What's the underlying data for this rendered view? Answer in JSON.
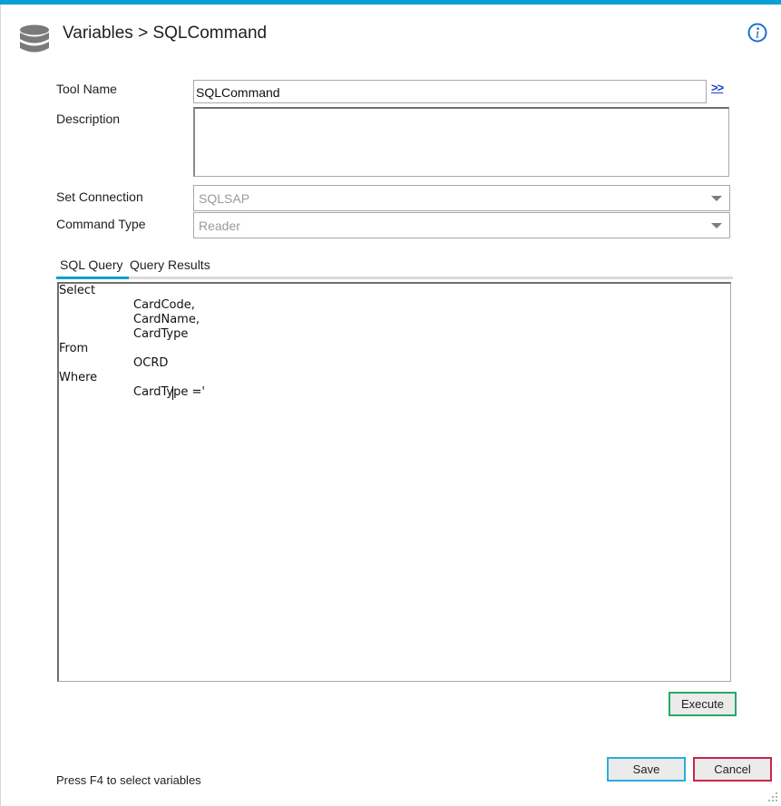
{
  "header": {
    "title": "Variables > SQLCommand",
    "icon": "database-icon",
    "info_icon": "info-icon"
  },
  "form": {
    "tool_name_label": "Tool Name",
    "tool_name_value": "SQLCommand",
    "expand_link": ">>",
    "description_label": "Description",
    "description_value": "",
    "set_connection_label": "Set Connection",
    "set_connection_value": "SQLSAP",
    "command_type_label": "Command Type",
    "command_type_value": "Reader"
  },
  "tabs": [
    {
      "label": "SQL Query",
      "active": true
    },
    {
      "label": "Query Results",
      "active": false
    }
  ],
  "editor": {
    "lines": [
      "Select",
      "        CardCode,",
      "        CardName,",
      "        CardType",
      "From",
      "        OCRD",
      "Where",
      "        CardType ='"
    ]
  },
  "buttons": {
    "execute": "Execute",
    "save": "Save",
    "cancel": "Cancel"
  },
  "footer": {
    "hint": "Press F4 to select variables"
  },
  "colors": {
    "accent": "#0aa0d2",
    "execute_border": "#28a86a",
    "save_border": "#2aaedb",
    "cancel_border": "#c8254e",
    "link": "#1a40c8"
  }
}
